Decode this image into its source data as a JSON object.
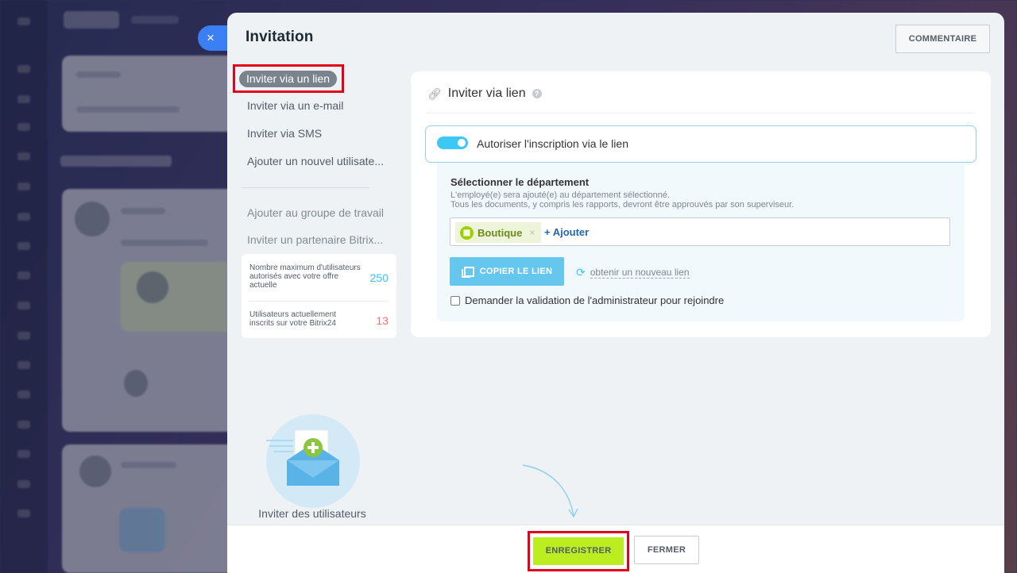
{
  "panel": {
    "title": "Invitation",
    "comment_button": "COMMENTAIRE",
    "close_tab_icon": "×"
  },
  "menu": {
    "active": "Inviter via un lien",
    "items": [
      "Inviter via un e-mail",
      "Inviter via SMS",
      "Ajouter un nouvel utilisate..."
    ],
    "secondary": [
      "Ajouter au groupe de travail",
      "Inviter un partenaire Bitrix..."
    ]
  },
  "stats": {
    "max_label": "Nombre maximum d'utilisateurs autorisés avec votre offre actuelle",
    "max_value": "250",
    "max_color": "#2fc6f6",
    "current_label": "Utilisateurs actuellement inscrits sur votre Bitrix24",
    "current_value": "13",
    "current_color": "#f0706a"
  },
  "illustration": {
    "caption": "Inviter des utilisateurs"
  },
  "card": {
    "heading": "Inviter via lien",
    "help_icon": "?",
    "toggle_label": "Autoriser l'inscription via le lien",
    "toggle_on": true,
    "department": {
      "title": "Sélectionner le département",
      "desc_line1": "L'employé(e) sera ajouté(e) au département sélectionné.",
      "desc_line2": "Tous les documents, y compris les rapports, devront être approuvés par son superviseur.",
      "tag": "Boutique",
      "tag_remove": "×",
      "add": "+ Ajouter"
    },
    "copy_button": "COPIER LE LIEN",
    "new_link": "obtenir un nouveau lien",
    "checkbox_label": "Demander la validation de l'administrateur pour rejoindre"
  },
  "footer": {
    "save": "ENREGISTRER",
    "close": "FERMER"
  },
  "colors": {
    "accent": "#3bc8f5",
    "save": "#bbed21",
    "highlight": "#e3001b"
  }
}
